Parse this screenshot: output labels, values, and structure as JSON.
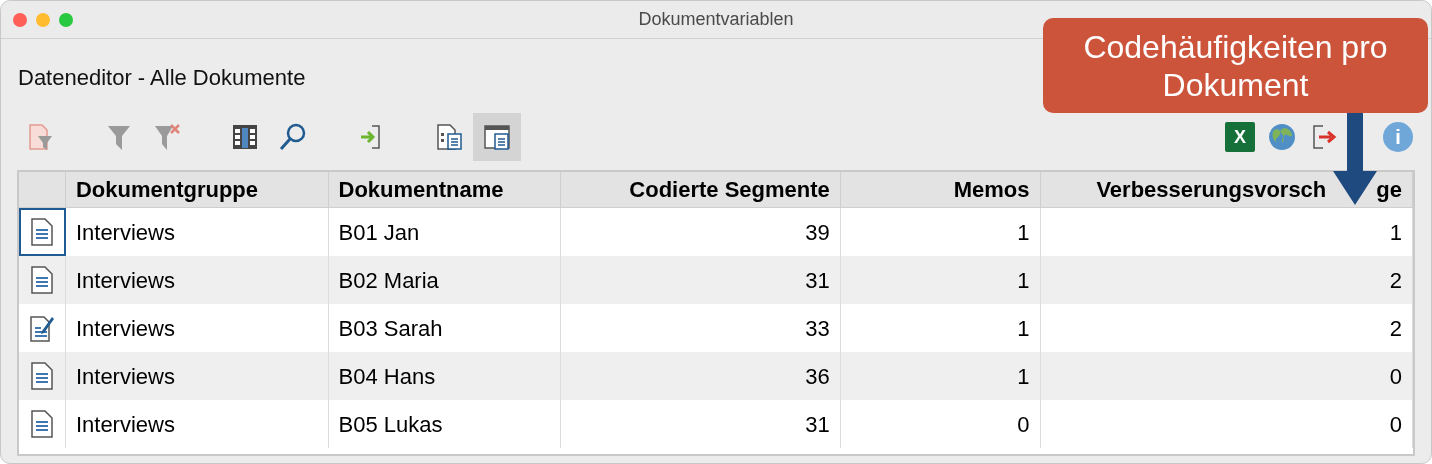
{
  "window": {
    "title": "Dokumentvariablen"
  },
  "heading": "Dateneditor - Alle Dokumente",
  "toolbar": {
    "left": [
      {
        "kind": "filter-doc",
        "selected": false
      },
      {
        "kind": "gap"
      },
      {
        "kind": "filter",
        "selected": false
      },
      {
        "kind": "filter-clear",
        "selected": false
      },
      {
        "kind": "gap"
      },
      {
        "kind": "columns",
        "selected": false
      },
      {
        "kind": "search",
        "selected": false
      },
      {
        "kind": "gap"
      },
      {
        "kind": "import",
        "selected": false
      },
      {
        "kind": "gap"
      },
      {
        "kind": "doc-list",
        "selected": false
      },
      {
        "kind": "doc-table",
        "selected": true
      }
    ],
    "right": [
      {
        "kind": "excel",
        "label": "X"
      },
      {
        "kind": "globe"
      },
      {
        "kind": "export"
      },
      {
        "kind": "gap"
      },
      {
        "kind": "info",
        "label": "i"
      }
    ]
  },
  "table": {
    "columns": [
      {
        "parts": [
          "Dokumentgruppe"
        ]
      },
      {
        "parts": [
          "Dokumentname"
        ]
      },
      {
        "parts": [
          "Codierte Segmente"
        ]
      },
      {
        "parts": [
          "Memos"
        ]
      },
      {
        "parts": [
          "Verbesserungsvorsch",
          "ge"
        ]
      }
    ],
    "rows": [
      {
        "kind": "document",
        "selected": true,
        "cells": [
          "Interviews",
          "B01 Jan",
          "39",
          "1",
          "1"
        ]
      },
      {
        "kind": "document",
        "selected": false,
        "cells": [
          "Interviews",
          "B02 Maria",
          "31",
          "1",
          "2"
        ]
      },
      {
        "kind": "document-edited",
        "selected": false,
        "cells": [
          "Interviews",
          "B03 Sarah",
          "33",
          "1",
          "2"
        ]
      },
      {
        "kind": "document",
        "selected": false,
        "cells": [
          "Interviews",
          "B04 Hans",
          "36",
          "1",
          "0"
        ]
      },
      {
        "kind": "document",
        "selected": false,
        "cells": [
          "Interviews",
          "B05 Lukas",
          "31",
          "0",
          "0"
        ]
      }
    ]
  },
  "callout": {
    "text": "Codehäufigkeiten pro Dokument"
  }
}
